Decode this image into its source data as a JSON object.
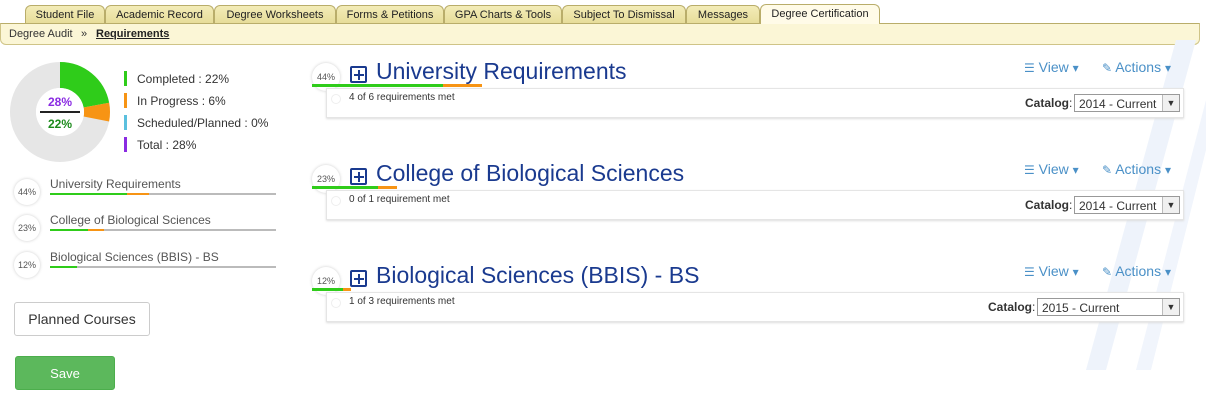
{
  "tabs": [
    "Student File",
    "Academic Record",
    "Degree Worksheets",
    "Forms & Petitions",
    "GPA Charts & Tools",
    "Subject To Dismissal",
    "Messages",
    "Degree Certification"
  ],
  "breadcrumb": {
    "parent": "Degree Audit",
    "separator": "»",
    "current": "Requirements"
  },
  "summary": {
    "donut_top": "28%",
    "donut_bottom": "22%",
    "completed_fraction": 0.22,
    "in_progress_fraction": 0.06,
    "legend": [
      {
        "label": "Completed : 22%",
        "color": "#2fcc1a"
      },
      {
        "label": "In Progress : 6%",
        "color": "#f79414"
      },
      {
        "label": "Scheduled/Planned : 0%",
        "color": "#5bc0de"
      },
      {
        "label": "Total : 28%",
        "color": "#8a2be2"
      }
    ]
  },
  "sidebar_items": [
    {
      "pct": "44%",
      "label": "University Requirements",
      "green": 0.34,
      "orange": 0.1
    },
    {
      "pct": "23%",
      "label": "College of Biological Sciences",
      "green": 0.17,
      "orange": 0.07
    },
    {
      "pct": "12%",
      "label": "Biological Sciences (BBIS) - BS",
      "green": 0.12,
      "orange": 0.0
    }
  ],
  "buttons": {
    "planned": "Planned Courses",
    "save": "Save"
  },
  "blocks": [
    {
      "pct": "44%",
      "title": "University Requirements",
      "met": "4 of 6 requirements met",
      "catalog_label": "Catalog",
      "catalog_sep": ":",
      "catalog_value": "2014 - Current",
      "view": "View",
      "actions": "Actions",
      "green": 0.34,
      "orange": 0.1
    },
    {
      "pct": "23%",
      "title": "College of Biological Sciences",
      "met": "0 of 1 requirement met",
      "catalog_label": "Catalog",
      "catalog_sep": ":",
      "catalog_value": "2014 - Current",
      "view": "View",
      "actions": "Actions",
      "green": 0.17,
      "orange": 0.05
    },
    {
      "pct": "12%",
      "title": "Biological Sciences (BBIS) - BS",
      "met": "1 of 3 requirements met",
      "catalog_label": "Catalog",
      "catalog_sep": ":",
      "catalog_value": "2015 - Current",
      "view": "View",
      "actions": "Actions",
      "green": 0.08,
      "orange": 0.02
    }
  ],
  "colors": {
    "green": "#2fcc1a",
    "orange": "#f79414",
    "title": "#1a3a8f",
    "link": "#4a90c7",
    "purple": "#8a2be2"
  }
}
